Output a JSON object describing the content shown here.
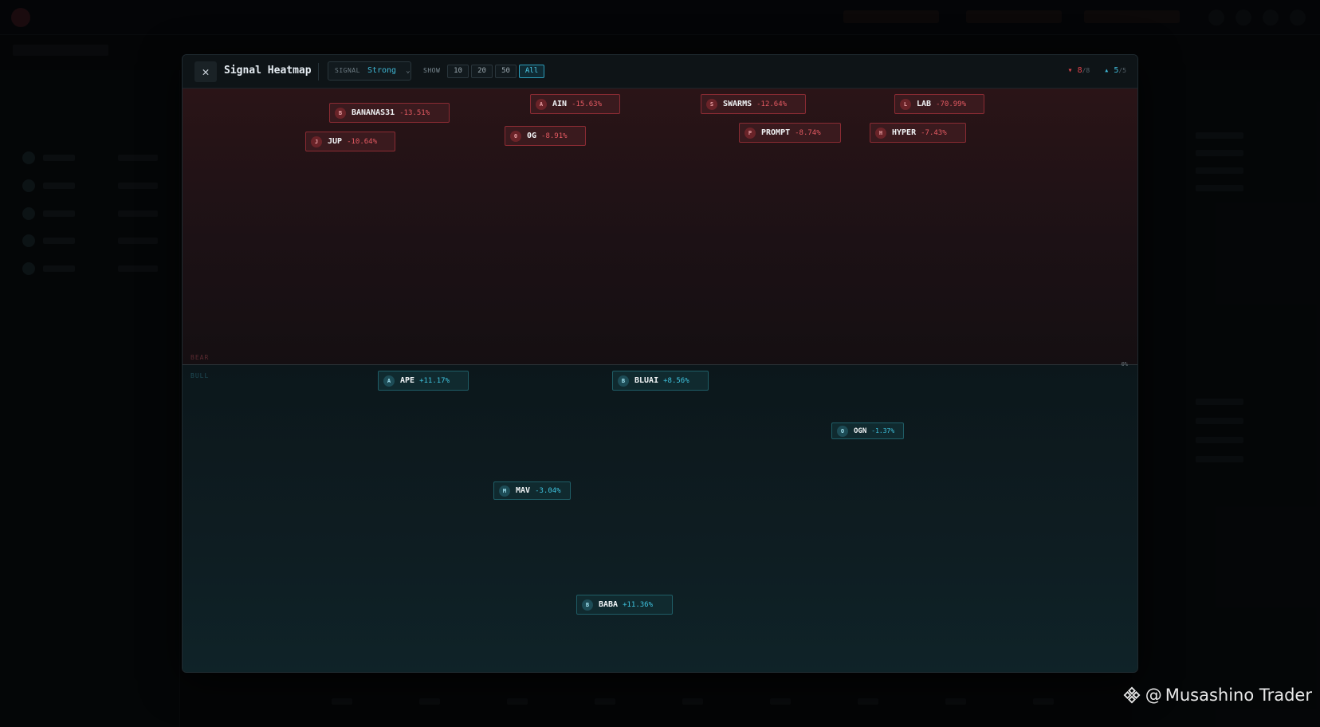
{
  "modal": {
    "close_symbol": "✕",
    "title": "Signal Heatmap",
    "signal_filter": {
      "label": "SIGNAL",
      "value": "Strong",
      "chevron": "⌄"
    },
    "show": {
      "label": "SHOW",
      "options": [
        "10",
        "20",
        "50",
        "All"
      ],
      "active": "All"
    },
    "counts": {
      "bear_arrow": "▾",
      "bear": "8",
      "bear_total": "/8",
      "bull_arrow": "▴",
      "bull": "5",
      "bull_total": "/5"
    }
  },
  "zones": {
    "bear_label": "BEAR",
    "bull_label": "BULL",
    "zero_label": "0%"
  },
  "bear_signals": [
    {
      "icon": "B",
      "symbol": "BANANAS31",
      "change": "-13.51%"
    },
    {
      "icon": "J",
      "symbol": "JUP",
      "change": "-10.64%"
    },
    {
      "icon": "A",
      "symbol": "AIN",
      "change": "-15.63%"
    },
    {
      "icon": "0",
      "symbol": "0G",
      "change": "-8.91%"
    },
    {
      "icon": "S",
      "symbol": "SWARMS",
      "change": "-12.64%"
    },
    {
      "icon": "P",
      "symbol": "PROMPT",
      "change": "-8.74%"
    },
    {
      "icon": "L",
      "symbol": "LAB",
      "change": "-70.99%"
    },
    {
      "icon": "H",
      "symbol": "HYPER",
      "change": "-7.43%"
    }
  ],
  "bull_signals": [
    {
      "icon": "A",
      "symbol": "APE",
      "change": "+11.17%"
    },
    {
      "icon": "B",
      "symbol": "BLUAI",
      "change": "+8.56%"
    },
    {
      "icon": "O",
      "symbol": "OGN",
      "change": "-1.37%"
    },
    {
      "icon": "M",
      "symbol": "MAV",
      "change": "-3.04%"
    },
    {
      "icon": "B",
      "symbol": "BABA",
      "change": "+11.36%"
    }
  ],
  "watermark": {
    "at": "@",
    "name": "Musashino Trader"
  },
  "colors": {
    "bear": "#e55a62",
    "bull": "#3fc3df",
    "accent": "#4fd0ee"
  }
}
